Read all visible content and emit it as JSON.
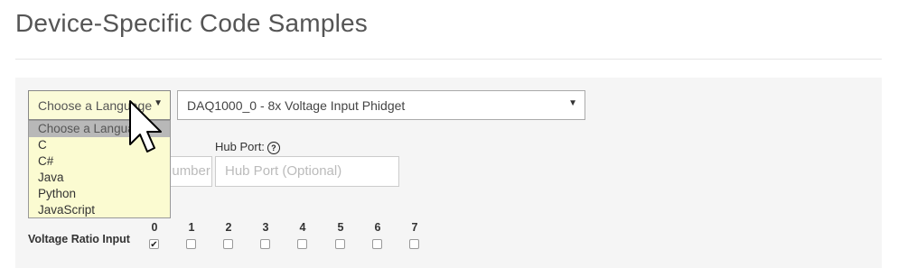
{
  "page": {
    "title": "Device-Specific Code Samples"
  },
  "language_select": {
    "selected": "Choose a Language",
    "options": [
      "Choose a Language",
      "C",
      "C#",
      "Java",
      "Python",
      "JavaScript"
    ]
  },
  "device_select": {
    "selected": "DAQ1000_0 - 8x Voltage Input Phidget"
  },
  "serial_field": {
    "placeholder": "Serial Number (Optional)"
  },
  "hub_port": {
    "label": "Hub Port:",
    "help": "?",
    "placeholder": "Hub Port (Optional)"
  },
  "channels": {
    "label": "Voltage Ratio Input",
    "items": [
      {
        "num": "0",
        "checked": true
      },
      {
        "num": "1",
        "checked": false
      },
      {
        "num": "2",
        "checked": false
      },
      {
        "num": "3",
        "checked": false
      },
      {
        "num": "4",
        "checked": false
      },
      {
        "num": "5",
        "checked": false
      },
      {
        "num": "6",
        "checked": false
      },
      {
        "num": "7",
        "checked": false
      }
    ]
  }
}
